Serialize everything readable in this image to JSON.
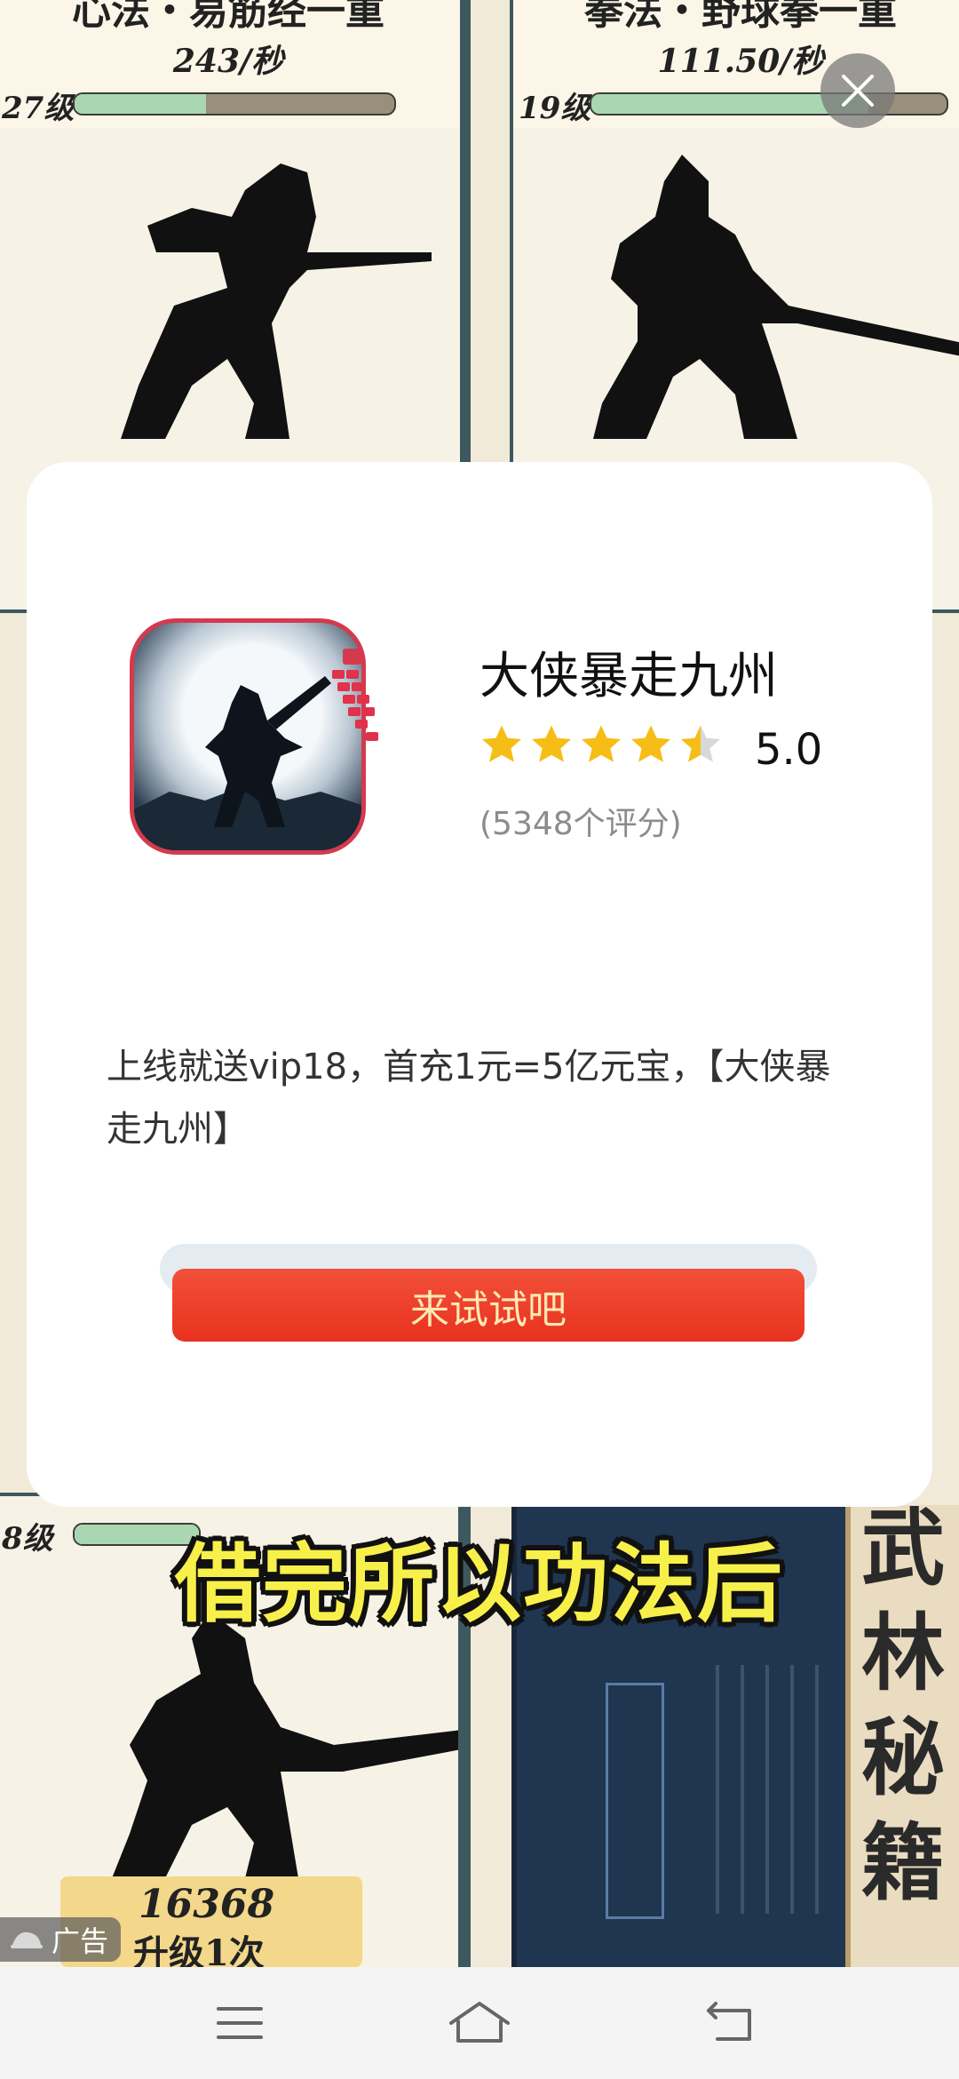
{
  "background": {
    "panels": [
      {
        "skill": "心法・易筋经一重",
        "rate": "243/秒",
        "level": "27级"
      },
      {
        "skill": "拳法・野球拳一重",
        "rate": "111.50/秒",
        "level": "19级"
      },
      {
        "level": "8级"
      }
    ],
    "subtitle": "借完所以功法后",
    "book_title": "武林秘籍",
    "upgrade_cost": "16368",
    "upgrade_label": "升级1次"
  },
  "ad": {
    "close_icon": "close-icon",
    "app_name": "大侠暴走九州",
    "rating": {
      "stars": 4.5,
      "score": "5.0",
      "count_text": "(5348个评分)"
    },
    "description": "上线就送vip18，首充1元=5亿元宝，【大侠暴走九州】",
    "cta_label": "来试试吧",
    "badge_label": "广告",
    "colors": {
      "cta": "#e8321f",
      "star": "#f6bd16",
      "icon_border": "#d43a4d"
    }
  },
  "nav": {
    "menu_icon": "menu-icon",
    "home_icon": "home-icon",
    "back_icon": "back-icon"
  }
}
